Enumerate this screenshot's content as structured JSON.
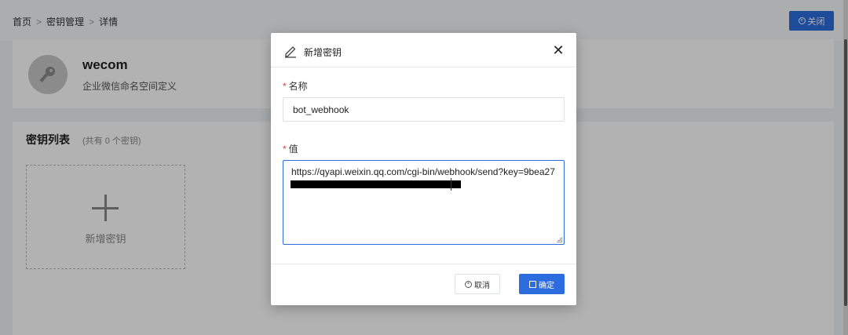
{
  "breadcrumb": {
    "home": "首页",
    "keys": "密钥管理",
    "detail": "详情",
    "separator": ">"
  },
  "header": {
    "close_label": "关闭"
  },
  "namespace": {
    "name": "wecom",
    "description": "企业微信命名空间定义"
  },
  "keys_section": {
    "title": "密钥列表",
    "count_text": "(共有 0 个密钥)",
    "add_label": "新增密钥"
  },
  "modal": {
    "title": "新增密钥",
    "name_label": "名称",
    "name_value": "bot_webhook",
    "value_label": "值",
    "value_text": "https://qyapi.weixin.qq.com/cgi-bin/webhook/send?key=9bea27",
    "required_mark": "*",
    "cancel_label": "取消",
    "confirm_label": "确定"
  },
  "colors": {
    "primary": "#2d6cdf",
    "required": "#e4393c"
  },
  "icons": {
    "edit": "edit-icon",
    "close": "close-icon",
    "key": "key-icon"
  }
}
